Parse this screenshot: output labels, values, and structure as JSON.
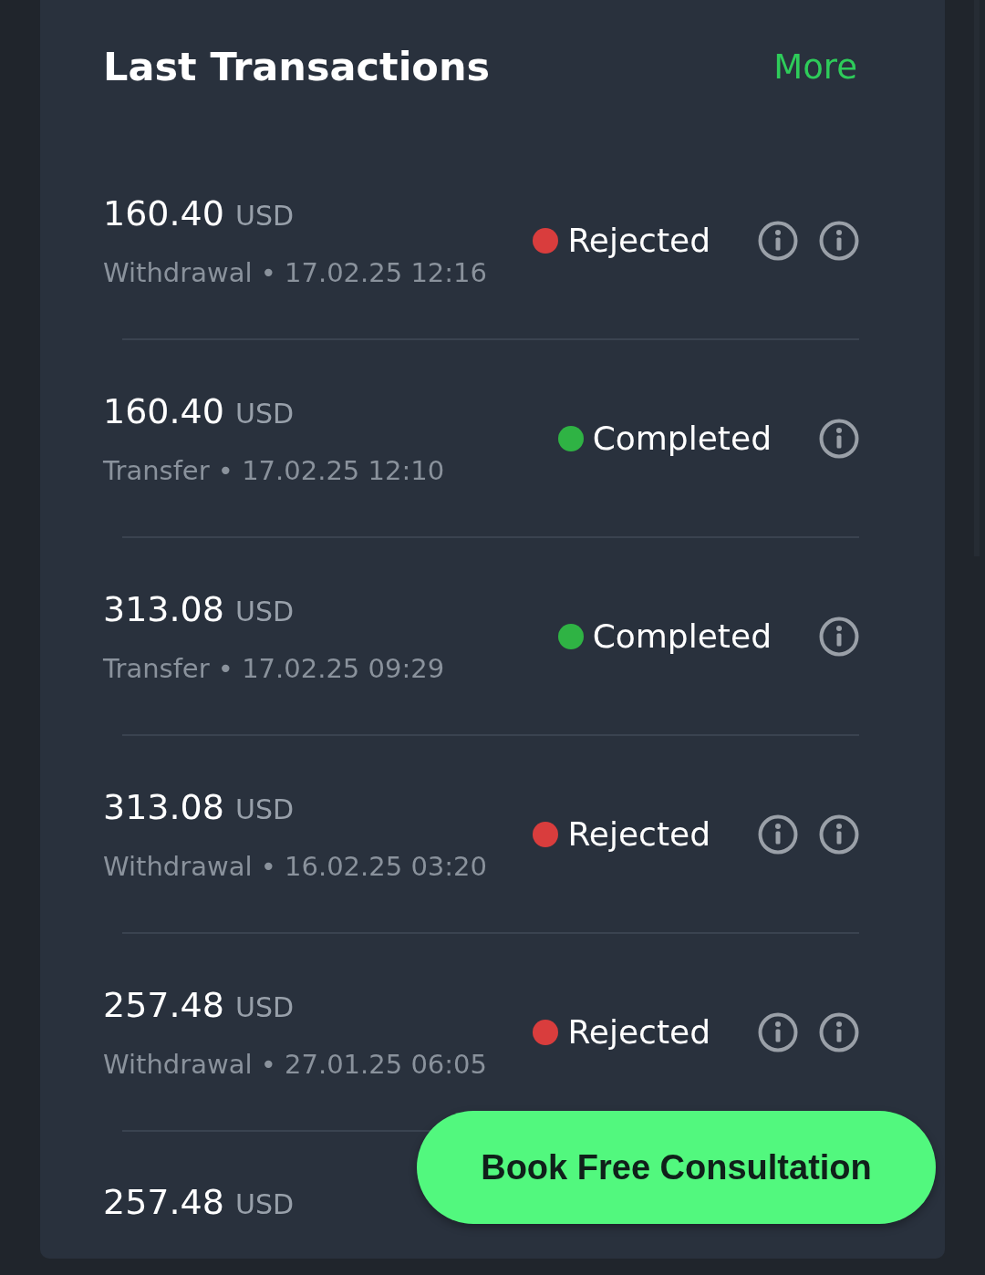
{
  "header": {
    "title": "Last Transactions",
    "more_link": "More"
  },
  "transactions": [
    {
      "amount": "160.40",
      "currency": "USD",
      "type": "Withdrawal",
      "separator": "•",
      "datetime": "17.02.25 12:16",
      "status": {
        "label": "Rejected",
        "color": "#d93d3d"
      },
      "actions": [
        {
          "kind": "info"
        },
        {
          "kind": "info"
        }
      ]
    },
    {
      "amount": "160.40",
      "currency": "USD",
      "type": "Transfer",
      "separator": "•",
      "datetime": "17.02.25 12:10",
      "status": {
        "label": "Completed",
        "color": "#2fb344"
      },
      "actions": [
        {
          "kind": "info"
        }
      ]
    },
    {
      "amount": "313.08",
      "currency": "USD",
      "type": "Transfer",
      "separator": "•",
      "datetime": "17.02.25 09:29",
      "status": {
        "label": "Completed",
        "color": "#2fb344"
      },
      "actions": [
        {
          "kind": "info"
        }
      ]
    },
    {
      "amount": "313.08",
      "currency": "USD",
      "type": "Withdrawal",
      "separator": "•",
      "datetime": "16.02.25 03:20",
      "status": {
        "label": "Rejected",
        "color": "#d93d3d"
      },
      "actions": [
        {
          "kind": "info"
        },
        {
          "kind": "info"
        }
      ]
    },
    {
      "amount": "257.48",
      "currency": "USD",
      "type": "Withdrawal",
      "separator": "•",
      "datetime": "27.01.25 06:05",
      "status": {
        "label": "Rejected",
        "color": "#d93d3d"
      },
      "actions": [
        {
          "kind": "info"
        },
        {
          "kind": "info"
        }
      ]
    },
    {
      "amount": "257.48",
      "currency": "USD"
    }
  ],
  "cta_button": {
    "label": "Book Free Consultation"
  }
}
